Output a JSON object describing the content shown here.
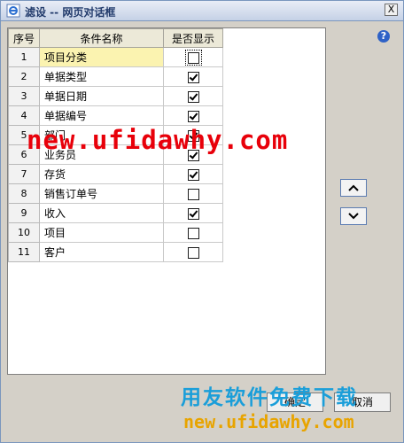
{
  "window": {
    "title": "滤设 -- 网页对话框",
    "close_label": "X",
    "help_label": "?"
  },
  "table": {
    "headers": {
      "seq": "序号",
      "name": "条件名称",
      "show": "是否显示"
    },
    "rows": [
      {
        "seq": "1",
        "name": "项目分类",
        "checked": false,
        "selected": true
      },
      {
        "seq": "2",
        "name": "单据类型",
        "checked": true
      },
      {
        "seq": "3",
        "name": "单据日期",
        "checked": true
      },
      {
        "seq": "4",
        "name": "单据编号",
        "checked": true
      },
      {
        "seq": "5",
        "name": "部门",
        "checked": true
      },
      {
        "seq": "6",
        "name": "业务员",
        "checked": true
      },
      {
        "seq": "7",
        "name": "存货",
        "checked": true
      },
      {
        "seq": "8",
        "name": "销售订单号",
        "checked": false
      },
      {
        "seq": "9",
        "name": "收入",
        "checked": true
      },
      {
        "seq": "10",
        "name": "项目",
        "checked": false
      },
      {
        "seq": "11",
        "name": "客户",
        "checked": false
      }
    ]
  },
  "buttons": {
    "ok_label": "确定",
    "cancel_label": "取消"
  },
  "watermark": {
    "line1": "new.ufidawhy.com",
    "line2": "用友软件免费下载",
    "line3": "new.ufidawhy.com"
  },
  "colors": {
    "watermark_red": "#e8000a",
    "watermark_blue": "#1a9ed9",
    "watermark_orange": "#e8a400",
    "selected_row": "#fbf3b0"
  }
}
